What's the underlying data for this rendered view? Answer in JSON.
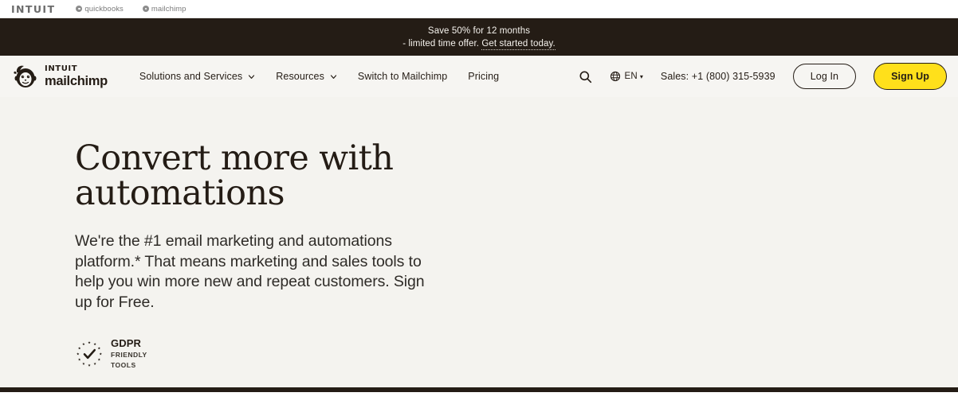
{
  "intuit_bar": {
    "logo": "INTUIT",
    "products": [
      {
        "name": "quickbooks",
        "icon": "circle-dot-icon"
      },
      {
        "name": "mailchimp",
        "icon": "circle-dot-icon"
      }
    ]
  },
  "promo_banner": {
    "line1": "Save 50% for 12 months",
    "line2_prefix": "- limited time offer. ",
    "link_text": "Get started today.",
    "background": "#241c15",
    "text_color": "#f6f3ee"
  },
  "nav": {
    "brand": {
      "intuit": "INTUIT",
      "mailchimp": "mailchimp",
      "logo_icon": "freddie-chimp-icon"
    },
    "links": [
      {
        "label": "Solutions and Services",
        "has_dropdown": true
      },
      {
        "label": "Resources",
        "has_dropdown": true
      },
      {
        "label": "Switch to Mailchimp",
        "has_dropdown": false
      },
      {
        "label": "Pricing",
        "has_dropdown": false
      }
    ],
    "search_icon": "search-icon",
    "language": {
      "code": "EN",
      "icon": "globe-icon",
      "caret": "▾"
    },
    "sales": "Sales: +1 (800) 315-5939",
    "login_label": "Log In",
    "signup_label": "Sign Up",
    "signup_color": "#ffe01b",
    "background": "#f6f5f2"
  },
  "hero": {
    "title": "Convert more with automations",
    "body": "We're the #1 email marketing and automations platform.* That means marketing and sales tools to help you win more new and repeat customers. Sign up for Free.",
    "gdpr": {
      "icon": "gdpr-stars-check-icon",
      "title": "GDPR",
      "line1": "FRIENDLY",
      "line2": "TOOLS"
    },
    "background": "#f4f3ef"
  }
}
